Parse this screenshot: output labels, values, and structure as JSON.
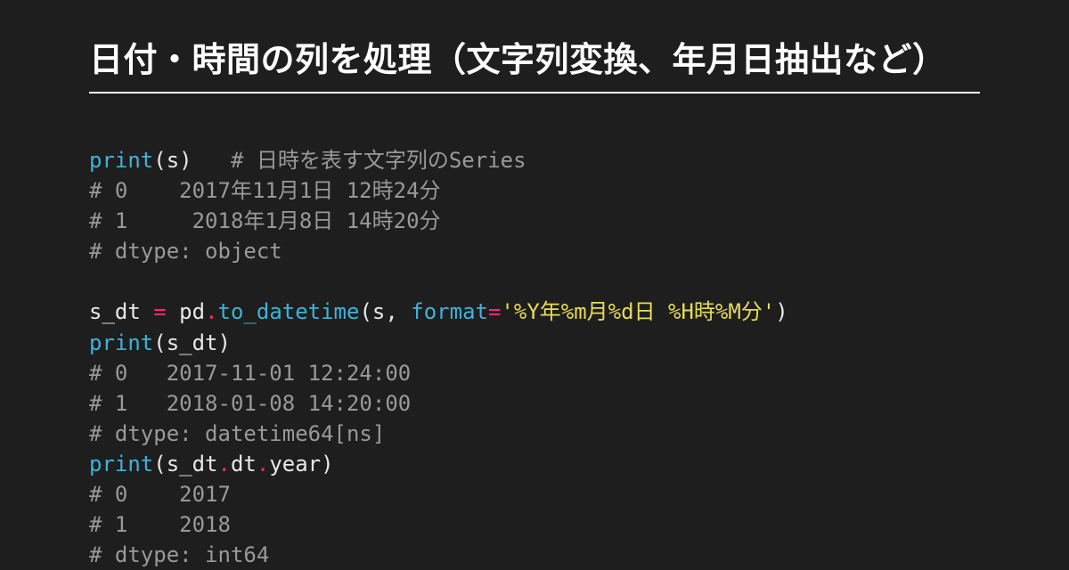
{
  "title": "日付・時間の列を処理（文字列変換、年月日抽出など）",
  "code": {
    "l1": {
      "fn": "print",
      "p1": "(s)   ",
      "c": "# 日時を表す文字列のSeries"
    },
    "l2": "# 0    2017年11月1日 12時24分",
    "l3": "# 1     2018年1月8日 14時20分",
    "l4": "# dtype: object",
    "l5": "",
    "l6": {
      "v": "s_dt ",
      "op1": "=",
      "sp": " pd",
      "dot1": ".",
      "fn": "to_datetime",
      "p1": "(s, ",
      "kw": "format",
      "op2": "=",
      "s": "'%Y年%m月%d日 %H時%M分'",
      "p2": ")"
    },
    "l7": {
      "fn": "print",
      "p1": "(s_dt)"
    },
    "l8": "# 0   2017-11-01 12:24:00",
    "l9": "# 1   2018-01-08 14:20:00",
    "l10": "# dtype: datetime64[ns]",
    "l11": {
      "fn": "print",
      "p1": "(s_dt",
      "dot1": ".",
      "attr1": "dt",
      "dot2": ".",
      "attr2": "year",
      "p2": ")"
    },
    "l12": "# 0    2017",
    "l13": "# 1    2018",
    "l14": "# dtype: int64"
  }
}
